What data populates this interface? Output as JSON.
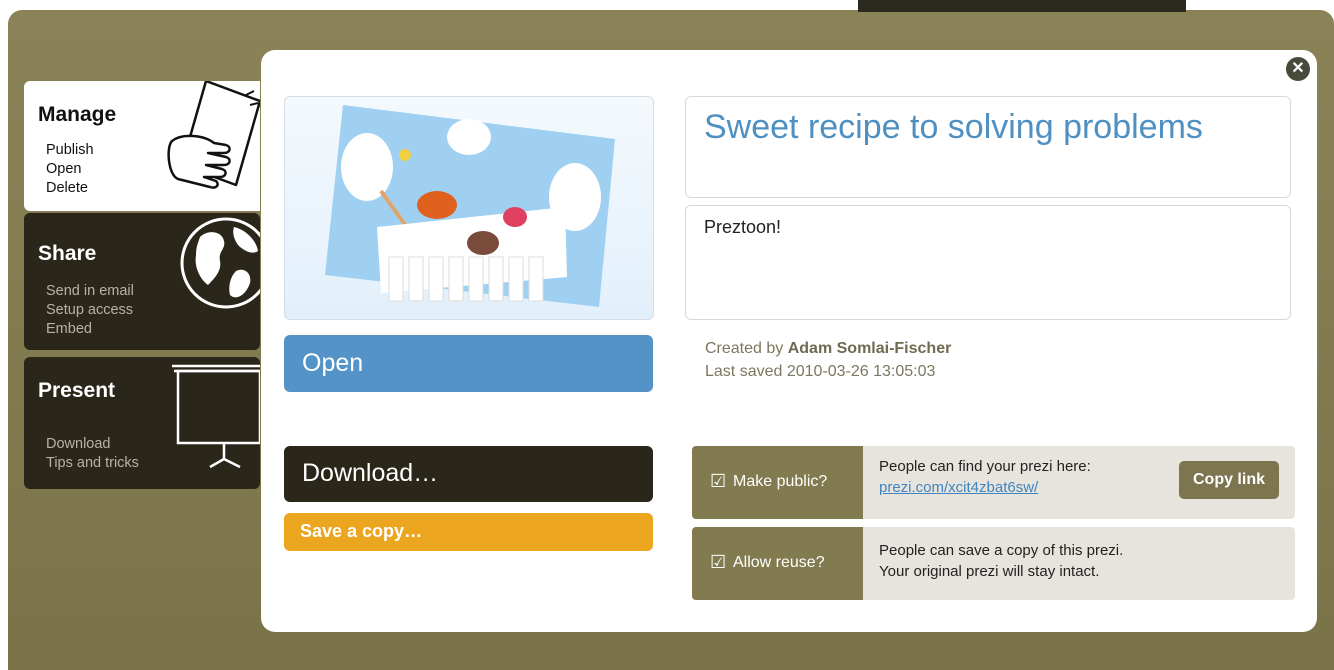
{
  "sidebar": {
    "manage": {
      "title": "Manage",
      "items": [
        "Publish",
        "Open",
        "Delete"
      ]
    },
    "share": {
      "title": "Share",
      "items": [
        "Send in email",
        "Setup access",
        "Embed"
      ]
    },
    "present": {
      "title": "Present",
      "items": [
        "Download",
        "Tips and tricks"
      ]
    }
  },
  "prezi": {
    "title": "Sweet recipe to solving problems",
    "description": "Preztoon!",
    "created_by_label": "Created by",
    "author": "Adam Somlai-Fischer",
    "last_saved": "Last saved 2010-03-26 13:05:03"
  },
  "buttons": {
    "open": "Open",
    "download": "Download…",
    "save_copy": "Save a copy…",
    "copy_link": "Copy link"
  },
  "options": {
    "make_public": {
      "label": "Make public?",
      "checked": true,
      "line1": "People can find your prezi here:",
      "link": "prezi.com/xcit4zbat6sw/"
    },
    "allow_reuse": {
      "label": "Allow reuse?",
      "checked": true,
      "line1": "People can save a copy of this prezi.",
      "line2": "Your original prezi will stay intact."
    }
  },
  "icons": {
    "close": "close-icon",
    "check": "checkbox-icon"
  },
  "colors": {
    "accent_blue": "#5493c8",
    "dark": "#2a2619",
    "orange": "#eba51e",
    "olive": "#827b50"
  }
}
